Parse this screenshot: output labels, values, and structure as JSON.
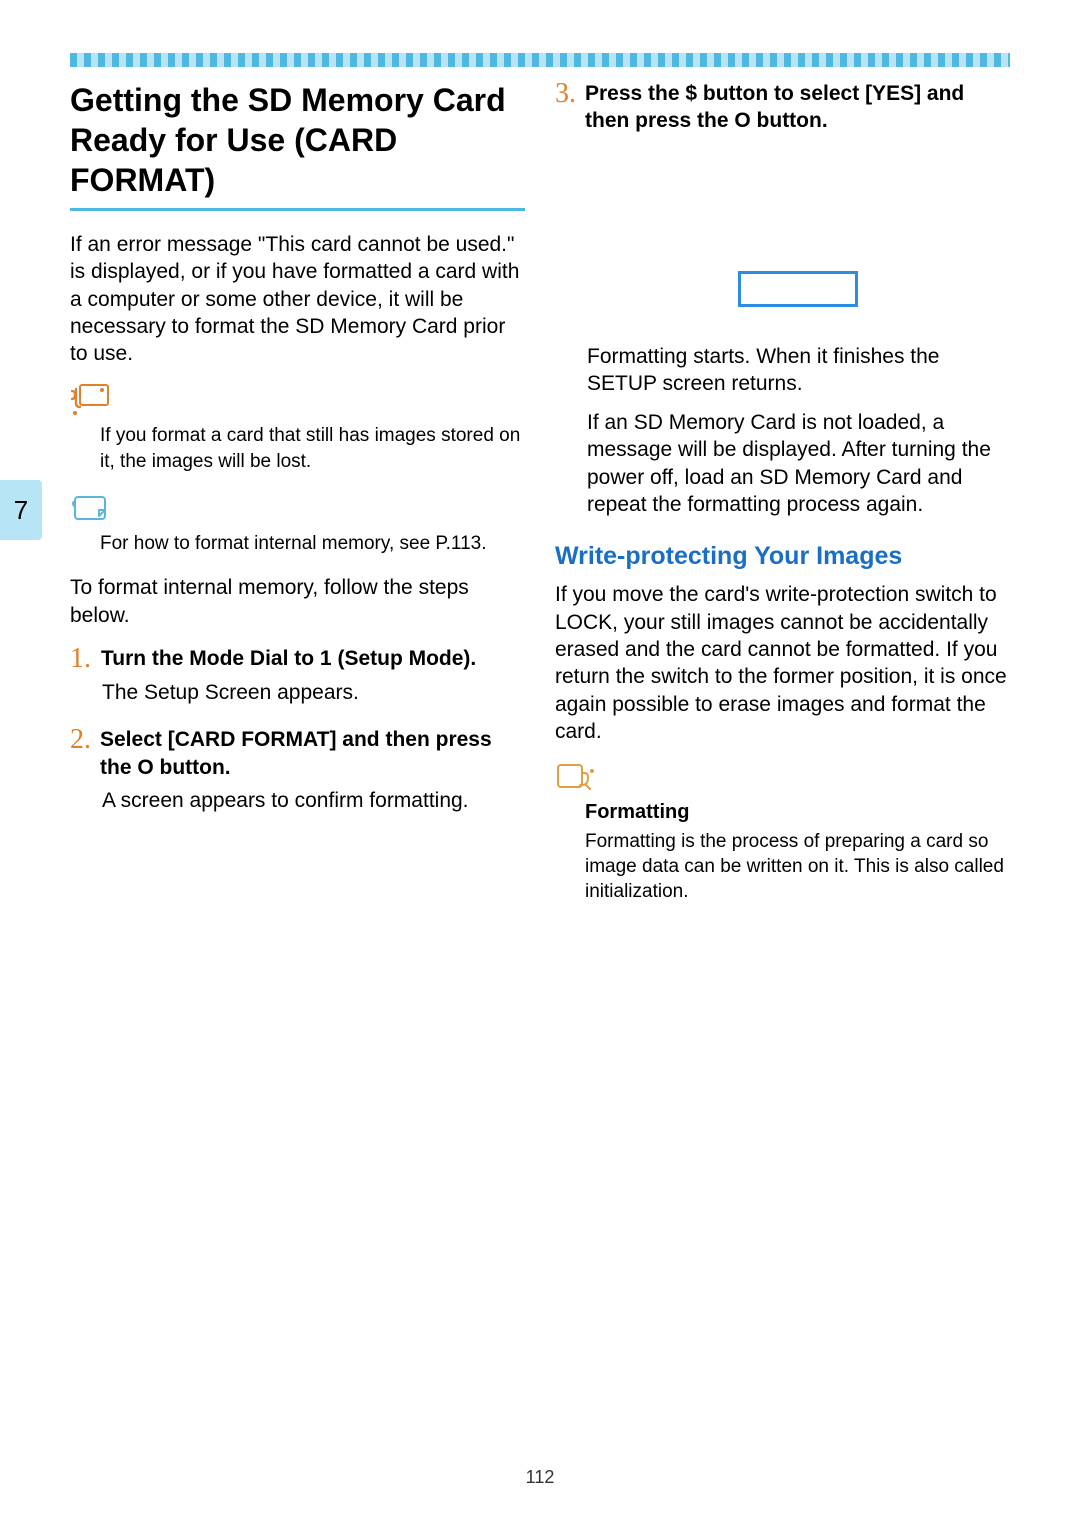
{
  "page_tab": "7",
  "page_number": "112",
  "left": {
    "heading": "Getting the SD Memory Card Ready for Use (CARD FORMAT)",
    "intro": "If an error message \"This card cannot be used.\" is displayed, or if you have formatted a card with a computer or some other device, it will be necessary to format the SD Memory Card prior to use.",
    "caution": "If you format a card that still has images stored on it, the images will be lost.",
    "note": "For how to format internal memory, see P.113.",
    "pre_steps": "To format internal memory, follow the steps below.",
    "step1_num": "1.",
    "step1_title": "Turn the Mode Dial to 1 (Setup Mode).",
    "step1_body": "The Setup Screen appears.",
    "step2_num": "2.",
    "step2_title": "Select  [CARD FORMAT] and then press the O    button.",
    "step2_body": "A screen appears to confirm formatting."
  },
  "right": {
    "step3_num": "3.",
    "step3_title": "Press the $  button to select [YES] and then press the O button.",
    "step3_body1": "Formatting starts. When it finishes the SETUP screen returns.",
    "step3_body2": "If an SD Memory Card is not loaded, a message will be displayed. After turning the power off, load an SD Memory Card and repeat the formatting process again.",
    "subheading": "Write-protecting Your Images",
    "sub_body": "If you move the card's write-protection switch to LOCK, your still images cannot be accidentally erased and the card cannot be formatted. If you return the switch to the former position, it is once again possible to erase images and format the card.",
    "term_title": "Formatting",
    "term_body": "Formatting is the process of preparing a card so image data can be written on it. This is also called initialization."
  }
}
